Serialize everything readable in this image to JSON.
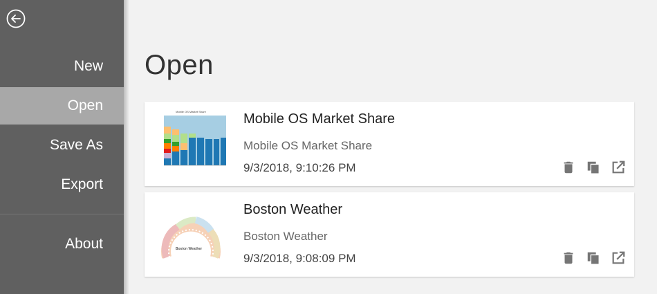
{
  "sidebar": {
    "back_icon": "arrow-left-circle-icon",
    "items": [
      {
        "label": "New"
      },
      {
        "label": "Open",
        "active": true
      },
      {
        "label": "Save As"
      },
      {
        "label": "Export"
      },
      {
        "label": "About"
      }
    ]
  },
  "main": {
    "title": "Open",
    "files": [
      {
        "title": "Mobile OS Market Share",
        "description": "Mobile OS Market Share",
        "date": "9/3/2018, 9:10:26 PM",
        "thumbnail_title": "Mobile OS Market Share",
        "thumbnail": "stacked-column-chart-thumbnail"
      },
      {
        "title": "Boston Weather",
        "description": "Boston Weather",
        "date": "9/3/2018, 9:08:09 PM",
        "thumbnail_title": "Boston Weather",
        "thumbnail": "radial-chart-thumbnail"
      }
    ],
    "actions": [
      "trash-icon",
      "copy-icon",
      "open-external-icon"
    ]
  },
  "colors": {
    "sidebar_bg": "#606060",
    "sidebar_active": "#a8a8a8",
    "content_bg": "#f2f2f2",
    "card_bg": "#ffffff",
    "icon_gray": "#757575"
  }
}
